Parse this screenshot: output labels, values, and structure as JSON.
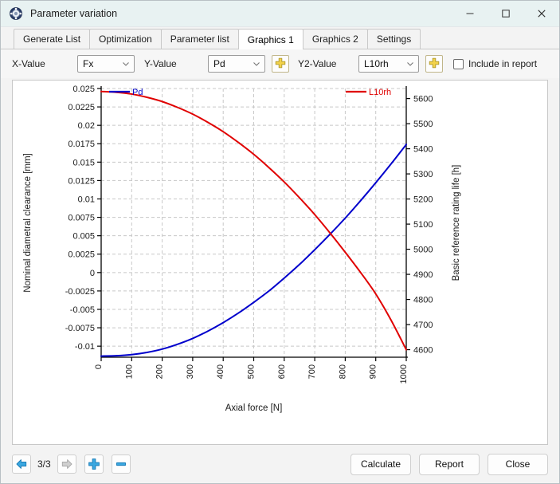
{
  "window": {
    "title": "Parameter variation",
    "icon": "bearing-icon",
    "minimize_label": "–",
    "maximize_label": "□",
    "close_label": "✕"
  },
  "tabs": [
    {
      "label": "Generate List",
      "active": false
    },
    {
      "label": "Optimization",
      "active": false
    },
    {
      "label": "Parameter list",
      "active": false
    },
    {
      "label": "Graphics 1",
      "active": true
    },
    {
      "label": "Graphics 2",
      "active": false
    },
    {
      "label": "Settings",
      "active": false
    }
  ],
  "controls": {
    "x_label": "X-Value",
    "x_value": "Fx",
    "y_label": "Y-Value",
    "y_value": "Pd",
    "y_add_label": "+",
    "y2_label": "Y2-Value",
    "y2_value": "L10rh",
    "y2_add_label": "+",
    "include_in_report_label": "Include in report",
    "include_in_report_checked": false
  },
  "bottom": {
    "prev_label": "←",
    "next_label": "→",
    "page_counter": "3/3",
    "add_label": "+",
    "remove_label": "−",
    "calculate_label": "Calculate",
    "report_label": "Report",
    "close_label": "Close"
  },
  "colors": {
    "series_pd": "#0000cc",
    "series_l10rh": "#e00000",
    "grid": "#c8c8c8",
    "axis": "#000000",
    "accent_blue": "#2196d8",
    "accent_yellow": "#f0cf4b"
  },
  "chart_data": {
    "type": "line",
    "title": "",
    "xlabel": "Axial force [N]",
    "ylabel": "Nominal diametral clearance [mm]",
    "y2label": "Basic reference rating life [h]",
    "grid": true,
    "legend_position": "inside-top",
    "xlim": [
      0,
      1000
    ],
    "xticks": [
      0,
      100,
      200,
      300,
      400,
      500,
      600,
      700,
      800,
      900,
      1000
    ],
    "xticklabels": [
      "0",
      "100",
      "200",
      "300",
      "400",
      "500",
      "600",
      "700",
      "800",
      "900",
      "1000"
    ],
    "ylim": [
      -0.0115,
      0.025
    ],
    "yticks": [
      0.025,
      0.0225,
      0.02,
      0.0175,
      0.015,
      0.0125,
      0.01,
      0.0075,
      0.005,
      0.0025,
      0,
      -0.0025,
      -0.005,
      -0.0075,
      -0.01
    ],
    "yticklabels": [
      "0.025",
      "0.0225",
      "0.02",
      "0.0175",
      "0.015",
      "0.0125",
      "0.01",
      "0.0075",
      "0.005",
      "0.0025",
      "0",
      "-0.0025",
      "-0.005",
      "-0.0075",
      "-0.01"
    ],
    "y2lim": [
      4570,
      5640
    ],
    "y2ticks": [
      5600,
      5500,
      5400,
      5300,
      5200,
      5100,
      5000,
      4900,
      4800,
      4700,
      4600
    ],
    "y2ticklabels": [
      "5600",
      "5500",
      "5400",
      "5300",
      "5200",
      "5100",
      "5000",
      "4900",
      "4800",
      "4700",
      "4600"
    ],
    "x": [
      0,
      50,
      100,
      150,
      200,
      250,
      300,
      350,
      400,
      450,
      500,
      550,
      600,
      650,
      700,
      750,
      800,
      850,
      900,
      950,
      1000
    ],
    "series": [
      {
        "name": "Pd",
        "axis": "left",
        "color": "#0000cc",
        "values": [
          -0.01135,
          -0.0113,
          -0.01115,
          -0.01085,
          -0.0104,
          -0.00975,
          -0.00895,
          -0.00795,
          -0.0068,
          -0.0055,
          -0.00405,
          -0.0025,
          -0.00075,
          0.0011,
          0.0031,
          0.0052,
          0.0074,
          0.00975,
          0.0122,
          0.01475,
          0.0174
        ]
      },
      {
        "name": "L10rh",
        "axis": "right",
        "color": "#e00000",
        "values": [
          5628,
          5625,
          5618,
          5605,
          5588,
          5565,
          5538,
          5505,
          5468,
          5425,
          5378,
          5325,
          5268,
          5205,
          5138,
          5065,
          4988,
          4908,
          4822,
          4718,
          4600
        ]
      }
    ]
  }
}
